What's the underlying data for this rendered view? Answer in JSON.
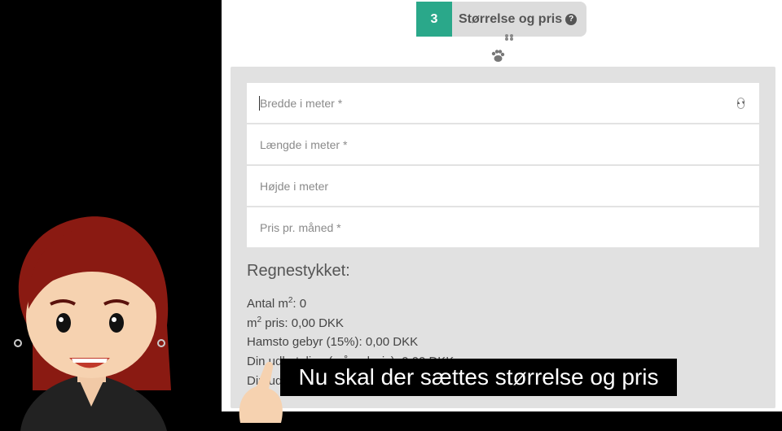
{
  "step": {
    "number": "3",
    "title": "Størrelse og pris",
    "help_icon": "question-circle-icon"
  },
  "form": {
    "width_placeholder": "Bredde i meter *",
    "length_placeholder": "Længde i meter *",
    "height_placeholder": "Højde i meter",
    "price_placeholder": "Pris pr. måned *"
  },
  "calc": {
    "title": "Regnestykket:",
    "count_label": "Antal m",
    "count_sup": "2",
    "count_value": ": 0",
    "m2_label": "m",
    "m2_sup": "2",
    "m2_value": " pris: 0,00 DKK",
    "fee": "Hamsto gebyr (15%): 0,00 DKK",
    "payout": "Din udbetaling (månedsvis): 0,00 DKK",
    "payout2": "Din ud"
  },
  "subtitle": "Nu skal der sættes størrelse og pris",
  "colors": {
    "accent": "#2aa88a",
    "card": "#e1e1e1"
  }
}
